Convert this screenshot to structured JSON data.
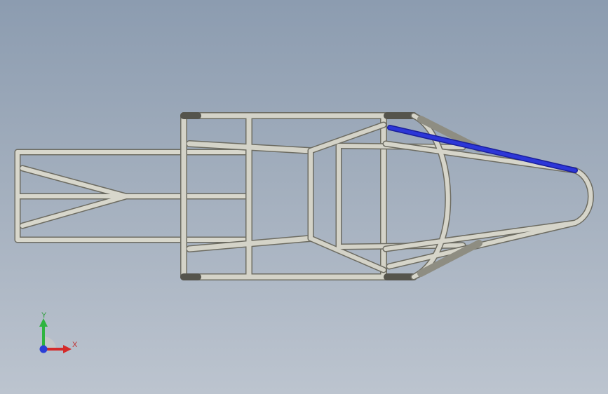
{
  "view": {
    "background_top": "#8c9cb0",
    "background_bottom": "#bcc4cf",
    "model": "tube-frame-chassis",
    "tube_color": "#c9c8bc",
    "selected_member_color": "#2c36d8"
  },
  "triad": {
    "x_label": "X",
    "y_label": "Y",
    "x_color": "#d42a2a",
    "y_color": "#2fb43f",
    "z_color": "#2b3ed6"
  }
}
